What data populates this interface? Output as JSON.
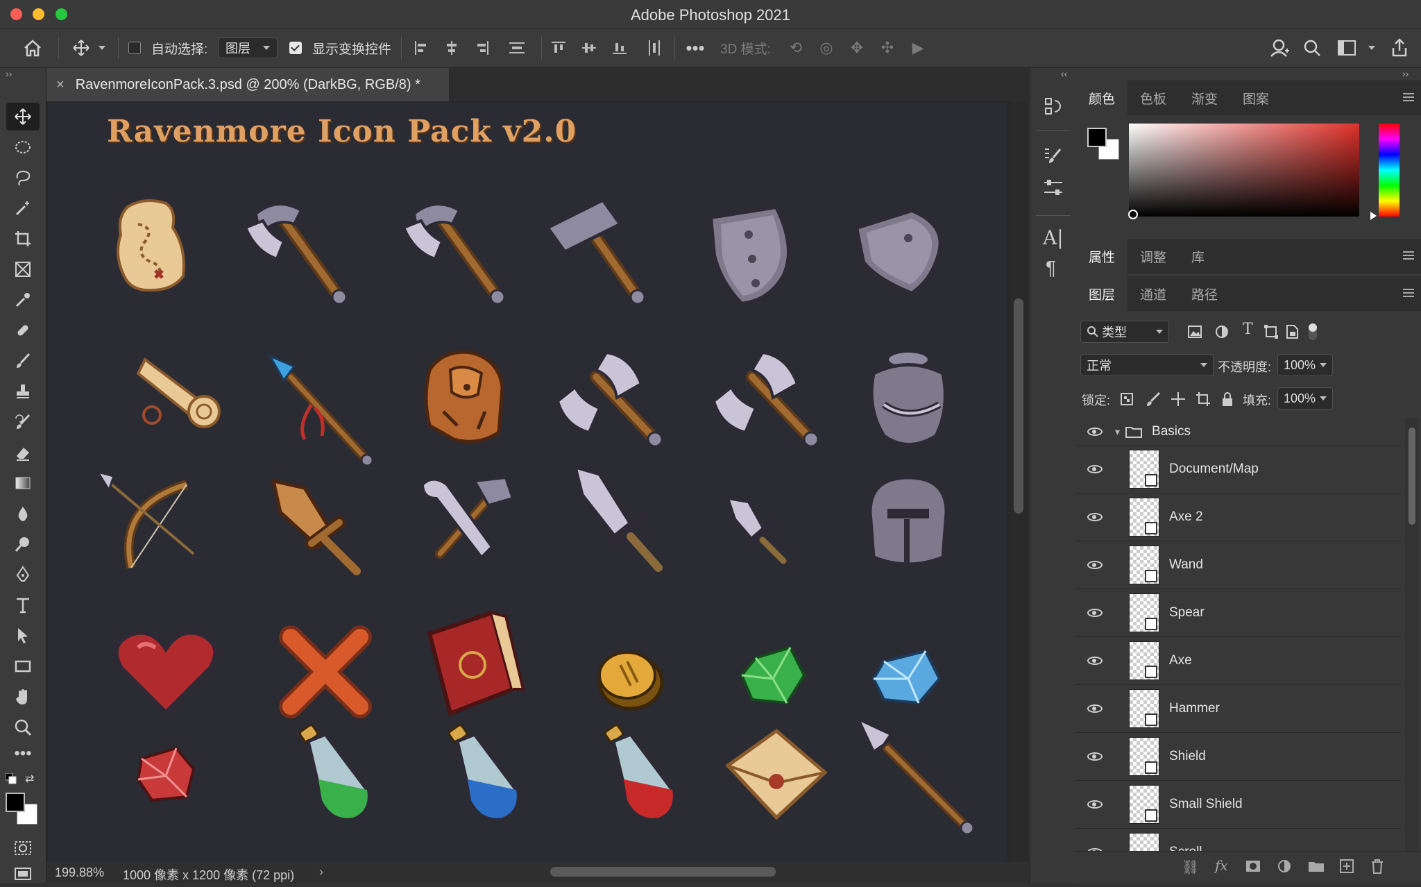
{
  "window": {
    "title": "Adobe Photoshop 2021"
  },
  "options_bar": {
    "auto_select_label": "自动选择:",
    "auto_select_value": "图层",
    "show_transform_label": "显示变换控件",
    "mode_3d_label": "3D 模式:"
  },
  "document": {
    "tab_title": "RavenmoreIconPack.3.psd @ 200% (DarkBG, RGB/8) *",
    "pack_title": "Ravenmore Icon Pack v2.0",
    "zoom": "199.88%",
    "dimensions": "1000 像素 x 1200 像素 (72 ppi)"
  },
  "icons": [
    "map-icon",
    "pickaxe-icon",
    "pickaxe-icon",
    "hammer-icon",
    "shield-icon",
    "small-shield-icon",
    "scroll-icon",
    "wand-icon",
    "backpack-icon",
    "double-axe-icon",
    "axe-icon",
    "armor-icon",
    "bow-icon",
    "wooden-sword-icon",
    "tools-icon",
    "sword-icon",
    "dagger-icon",
    "helmet-icon",
    "heart-icon",
    "cross-icon",
    "book-icon",
    "coin-icon",
    "emerald-icon",
    "diamond-icon",
    "ruby-icon",
    "green-potion-icon",
    "blue-potion-icon",
    "red-potion-icon",
    "letter-icon",
    "spear-icon"
  ],
  "panels": {
    "color_tabs": [
      "颜色",
      "色板",
      "渐变",
      "图案"
    ],
    "props_tabs": [
      "属性",
      "调整",
      "库"
    ],
    "layers_tabs": [
      "图层",
      "通道",
      "路径"
    ],
    "filter_label": "类型",
    "blend_mode": "正常",
    "opacity_label": "不透明度:",
    "opacity_value": "100%",
    "lock_label": "锁定:",
    "fill_label": "填充:",
    "fill_value": "100%",
    "group_name": "Basics",
    "layers": [
      "Document/Map",
      "Axe 2",
      "Wand",
      "Spear",
      "Axe",
      "Hammer",
      "Shield",
      "Small Shield",
      "Scroll"
    ]
  },
  "colors": {
    "accent": "#e0a062",
    "canvas_bg": "#2b2b33",
    "panel_bg": "#383838"
  }
}
